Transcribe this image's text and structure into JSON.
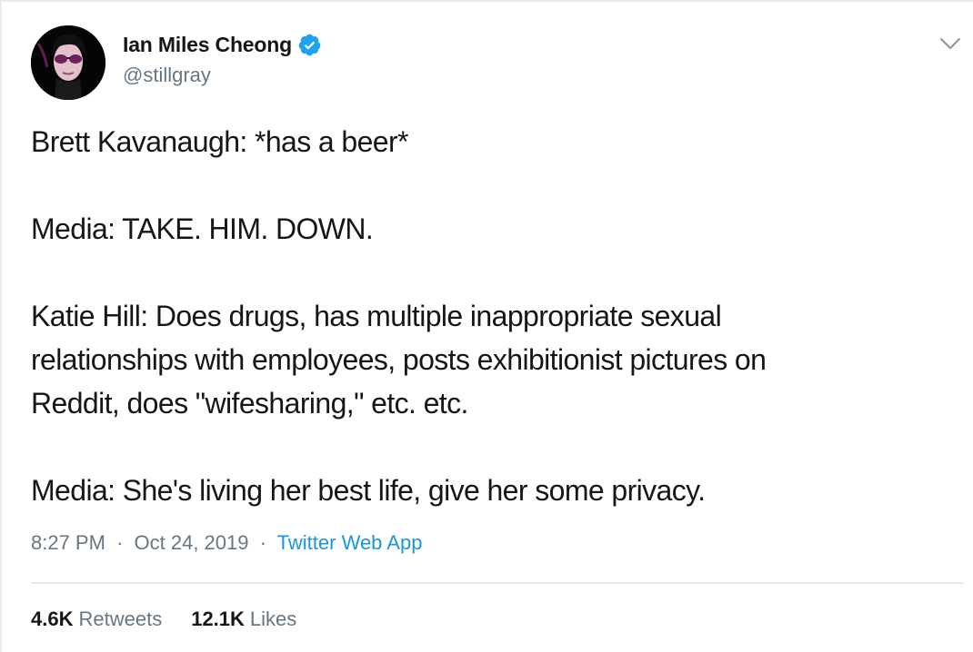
{
  "author": {
    "name": "Ian Miles Cheong",
    "handle": "@stillgray",
    "verified": true,
    "avatar_icon": "profile-avatar"
  },
  "tweet": {
    "text": "Brett Kavanaugh: *has a beer*\n\nMedia: TAKE. HIM. DOWN.\n\nKatie Hill: Does drugs, has multiple inappropriate sexual\nrelationships with employees, posts exhibitionist pictures on\nReddit, does \"wifesharing,\" etc. etc.\n\nMedia: She's living her best life, give her some privacy.",
    "time": "8:27 PM",
    "date": "Oct 24, 2019",
    "separator": "·",
    "source": "Twitter Web App"
  },
  "stats": {
    "retweets_count": "4.6K",
    "retweets_label": "Retweets",
    "likes_count": "12.1K",
    "likes_label": "Likes"
  },
  "colors": {
    "text": "#14171a",
    "secondary": "#657786",
    "link": "#1b95e0",
    "verified": "#1da1f2",
    "border": "#e6ecf0"
  }
}
